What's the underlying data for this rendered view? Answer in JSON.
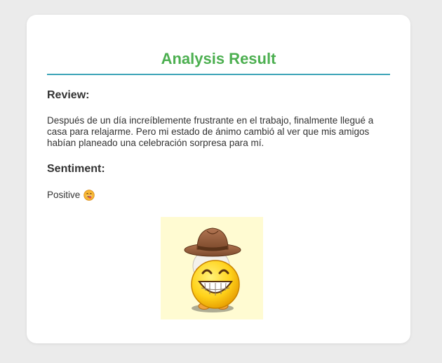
{
  "result": {
    "title": "Analysis Result",
    "review_heading": "Review:",
    "review_text": "Después de un día increíblemente frustrante en el trabajo, finalmente llegué a casa para relajarme. Pero mi estado de ánimo cambió al ver que mis amigos habían planeado una celebración sorpresa para mí.",
    "sentiment_heading": "Sentiment:",
    "sentiment_value": "Positive"
  },
  "icons": {
    "sentiment_emoji": "grinning-tongue-emoji-icon",
    "illustration": "cowboy-hat-grinning-emoji-icon"
  },
  "colors": {
    "title": "#4caf50",
    "rule": "#3ea5b8",
    "background": "#ebebeb",
    "card": "#ffffff",
    "image_background": "#fffbd2"
  }
}
